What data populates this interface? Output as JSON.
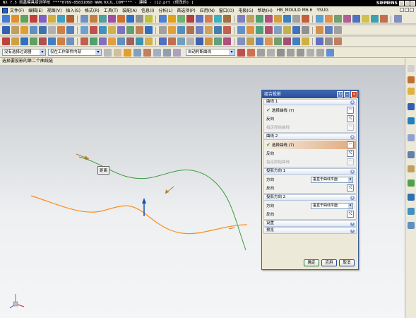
{
  "window": {
    "title": "NX 7.5 凯鑫模具培训学校  ****0769-85831060  WWW.KXJL.COM**** - 建模 - [12.prt (修改的) ]",
    "brand": "SIEMENS"
  },
  "menubar": {
    "items": [
      "文件(F)",
      "编辑(E)",
      "视图(V)",
      "插入(S)",
      "格式(R)",
      "工具(T)",
      "装配(A)",
      "信息(I)",
      "分析(L)",
      "首选项(P)",
      "应用(N)",
      "窗口(O)",
      "电极(G)",
      "帮助(H)",
      "HB_MOULD M6.6",
      "YSUG"
    ]
  },
  "filterbar": {
    "type_filter": "没有选择过滤器",
    "scope": "仅在工作部件内部",
    "snap_mode": "自动判断曲线"
  },
  "cue_line": "选择要投影的第二个曲线链",
  "viewport": {
    "callout_label": "距离"
  },
  "dialog": {
    "title": "组合投影",
    "sections": {
      "curve1": {
        "header": "曲线 1",
        "select_label": "选择曲线 (7)",
        "reverse_label": "反向",
        "origin_label": "指定原始曲线"
      },
      "curve2": {
        "header": "曲线 2",
        "select_label": "选择曲线 (7)",
        "reverse_label": "反向",
        "origin_label": "指定原始曲线"
      },
      "dir1": {
        "header": "投影方向 1",
        "direction_label": "方向",
        "direction_value": "垂直于曲线平面",
        "reverse_label": "反向"
      },
      "dir2": {
        "header": "投影方向 2",
        "direction_label": "方向",
        "direction_value": "垂直于曲线平面",
        "reverse_label": "反向"
      },
      "settings": {
        "header": "设置"
      },
      "preview": {
        "header": "预览"
      }
    },
    "buttons": {
      "ok": "确定",
      "apply": "应用",
      "cancel": "取消"
    }
  },
  "colors": {
    "curve_green": "#3c9a3c",
    "curve_orange": "#ff8c1a",
    "dialog_title": "#2a4f99"
  }
}
